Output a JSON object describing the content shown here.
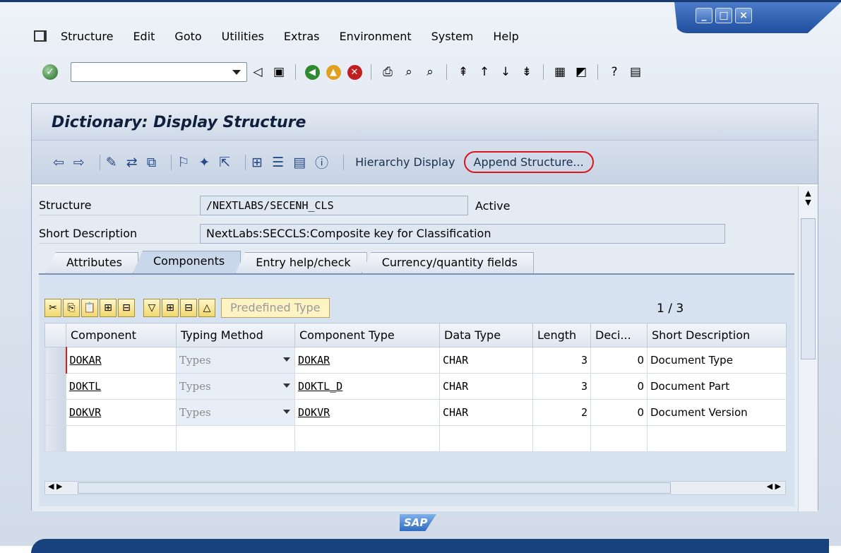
{
  "menu": {
    "items": [
      "Structure",
      "Edit",
      "Goto",
      "Utilities",
      "Extras",
      "Environment",
      "System",
      "Help"
    ]
  },
  "panel": {
    "title": "Dictionary: Display Structure",
    "hierarchy_label": "Hierarchy Display",
    "append_label": "Append Structure..."
  },
  "fields": {
    "structure_label": "Structure",
    "structure_value": "/NEXTLABS/SECENH_CLS",
    "status": "Active",
    "short_desc_label": "Short Description",
    "short_desc_value": "NextLabs:SECCLS:Composite key for Classification"
  },
  "tabs": [
    "Attributes",
    "Components",
    "Entry help/check",
    "Currency/quantity fields"
  ],
  "table_toolbar": {
    "predefined_type": "Predefined Type",
    "pager": "1 / 3"
  },
  "table": {
    "headers": [
      "Component",
      "Typing Method",
      "Component Type",
      "Data Type",
      "Length",
      "Deci...",
      "Short Description"
    ],
    "rows": [
      {
        "component": "DOKAR",
        "typing": "Types",
        "ctype": "DOKAR",
        "dtype": "CHAR",
        "length": "3",
        "dec": "0",
        "desc": "Document Type"
      },
      {
        "component": "DOKTL",
        "typing": "Types",
        "ctype": "DOKTL_D",
        "dtype": "CHAR",
        "length": "3",
        "dec": "0",
        "desc": "Document Part"
      },
      {
        "component": "DOKVR",
        "typing": "Types",
        "ctype": "DOKVR",
        "dtype": "CHAR",
        "length": "2",
        "dec": "0",
        "desc": "Document Version"
      }
    ]
  },
  "logo": "SAP",
  "colors": {
    "append_highlight": "#d9161d",
    "title_bar": "#1f4f9e"
  }
}
